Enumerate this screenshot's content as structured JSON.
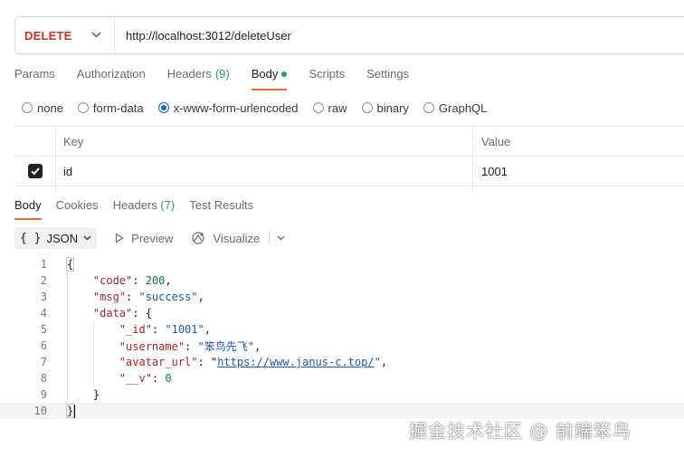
{
  "request": {
    "method": "DELETE",
    "url": "http://localhost:3012/deleteUser"
  },
  "request_tabs": [
    {
      "label": "Params",
      "count": ""
    },
    {
      "label": "Authorization",
      "count": ""
    },
    {
      "label": "Headers",
      "count": "(9)"
    },
    {
      "label": "Body",
      "count": ""
    },
    {
      "label": "Scripts",
      "count": ""
    },
    {
      "label": "Settings",
      "count": ""
    }
  ],
  "body_types": [
    "none",
    "form-data",
    "x-www-form-urlencoded",
    "raw",
    "binary",
    "GraphQL"
  ],
  "selected_body_type": "x-www-form-urlencoded",
  "params_table": {
    "headers": {
      "key": "Key",
      "value": "Value"
    },
    "rows": [
      {
        "enabled": true,
        "key": "id",
        "value": "1001"
      }
    ]
  },
  "response_tabs": [
    {
      "label": "Body",
      "count": ""
    },
    {
      "label": "Cookies",
      "count": ""
    },
    {
      "label": "Headers",
      "count": "(7)"
    },
    {
      "label": "Test Results",
      "count": ""
    }
  ],
  "response_toolbar": {
    "format_icon": "{ }",
    "format": "JSON",
    "preview": "Preview",
    "visualize": "Visualize"
  },
  "response_body": {
    "line_numbers": [
      "1",
      "2",
      "3",
      "4",
      "5",
      "6",
      "7",
      "8",
      "9",
      "10"
    ],
    "code_key": "\"code\"",
    "code_value": "200",
    "msg_key": "\"msg\"",
    "msg_value": "\"success\"",
    "data_key": "\"data\"",
    "id_key": "\"_id\"",
    "id_value": "\"1001\"",
    "username_key": "\"username\"",
    "username_value": "\"笨鸟先飞\"",
    "avatar_key": "\"avatar_url\"",
    "avatar_value": "https://www.janus-c.top/",
    "v_key": "\"__v\"",
    "v_value": "0"
  },
  "watermark": "掘金技术社区 @ 前端笨鸟",
  "colors": {
    "method": "#c4302b",
    "active_tab_underline": "#f26b3a",
    "count_green": "#2b9a66",
    "radio_selected": "#0265d2",
    "json_key": "#a3252d",
    "json_string": "#1f56a8",
    "json_number": "#107d41"
  }
}
